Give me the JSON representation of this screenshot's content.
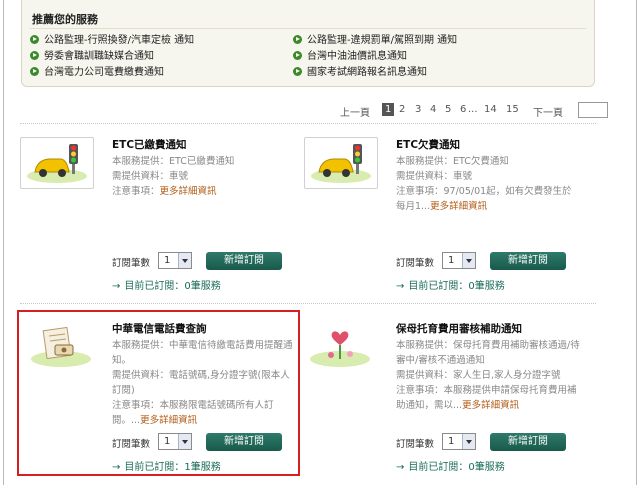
{
  "recommended": {
    "title": "推薦您的服務",
    "items": [
      "公路監理-行照換發/汽車定檢 通知",
      "公路監理-違規罰單/駕照到期 通知",
      "勞委會職訓職缺媒合通知",
      "台灣中油油價訊息通知",
      "台灣電力公司電費繳費通知",
      "國家考試網路報名訊息通知"
    ]
  },
  "pagination": {
    "prev": "上一頁",
    "current": "1",
    "pages": [
      "2",
      "3",
      "4",
      "5",
      "6",
      "...",
      "14",
      "15"
    ],
    "next": "下一頁"
  },
  "services": [
    {
      "title": "ETC已繳費通知",
      "lines": [
        "本服務提供：ETC已繳費通知",
        "需提供資料：車號",
        "注意事項："
      ],
      "more": "更多詳細資訊",
      "count_label": "訂閱筆數",
      "count_value": "1",
      "add_label": "新增訂閱",
      "status": "目前已訂閱：0筆服務",
      "icon": "car-icon"
    },
    {
      "title": "ETC欠費通知",
      "lines": [
        "本服務提供：ETC欠費通知",
        "需提供資料：車號",
        "注意事項：97/05/01起，如有欠費發生於每月1..."
      ],
      "more": "更多詳細資訊",
      "count_label": "訂閱筆數",
      "count_value": "1",
      "add_label": "新增訂閱",
      "status": "目前已訂閱：0筆服務",
      "icon": "car-icon"
    },
    {
      "title": "中華電信電話費查詢",
      "lines": [
        "本服務提供：中華電信待繳電話費用提醒通知。",
        "需提供資料：電話號碼,身分證字號(限本人訂閱)",
        "注意事項：本服務限電話號碼所有人訂閱。..."
      ],
      "more": "更多詳細資訊",
      "count_label": "訂閱筆數",
      "count_value": "1",
      "add_label": "新增訂閱",
      "status": "目前已訂閱：1筆服務",
      "icon": "phone-bill-icon"
    },
    {
      "title": "保母托育費用審核補助通知",
      "lines": [
        "本服務提供：保母托育費用補助審核通過/待審中/審核不通過通知",
        "需提供資料：家人生日,家人身分證字號",
        "注意事項：本服務提供申請保母托育費用補助通知，需以..."
      ],
      "more": "更多詳細資訊",
      "count_label": "訂閱筆數",
      "count_value": "1",
      "add_label": "新增訂閱",
      "status": "目前已訂閱：0筆服務",
      "icon": "childcare-icon"
    }
  ],
  "colors": {
    "accent": "#1a6b58",
    "highlight": "#d71f1f",
    "more_link": "#b05b16"
  }
}
